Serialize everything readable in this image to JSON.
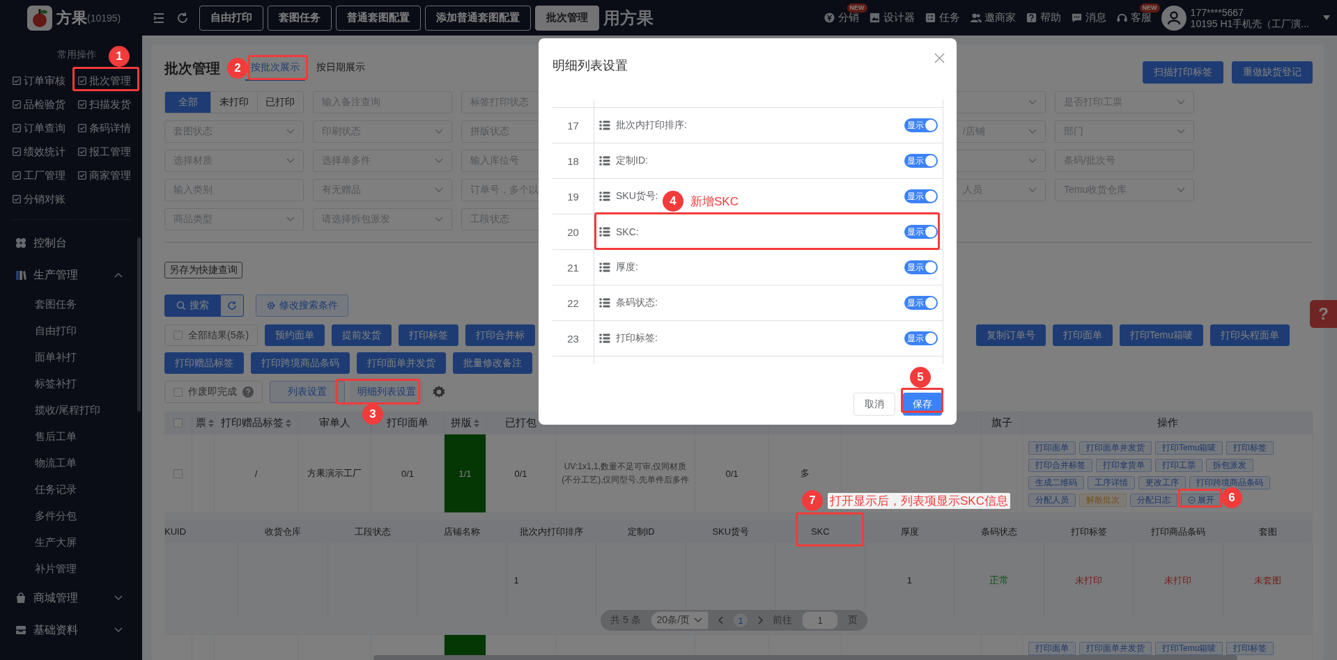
{
  "topbar": {
    "brand": "方果",
    "account": "(10195)",
    "banner_text": "用方果",
    "tabs": [
      {
        "label": "自由打印",
        "selected": false
      },
      {
        "label": "套图任务",
        "selected": false
      },
      {
        "label": "普通套图配置",
        "selected": false
      },
      {
        "label": "添加普通套图配置",
        "selected": false
      },
      {
        "label": "批次管理",
        "selected": true
      }
    ],
    "tools": [
      {
        "label": "分销",
        "badge": "NEW"
      },
      {
        "label": "设计器"
      },
      {
        "label": "任务"
      },
      {
        "label": "邀商家"
      },
      {
        "label": "帮助"
      },
      {
        "label": "消息"
      },
      {
        "label": "客服",
        "badge": "NEW"
      }
    ],
    "user": {
      "phone": "177****5667",
      "org": "10195  H1手机壳（工厂演..."
    }
  },
  "sidebar": {
    "quick_title": "常用操作",
    "quick_links": [
      "订单审核",
      "批次管理",
      "品检验货",
      "扫描发货",
      "订单查询",
      "条码详情",
      "绩效统计",
      "报工管理",
      "工厂管理",
      "商家管理",
      "分销对账"
    ],
    "menu": [
      {
        "label": "控制台",
        "kind": "link"
      },
      {
        "label": "生产管理",
        "kind": "group",
        "expanded": true,
        "children": [
          "套图任务",
          "自由打印",
          "面单补打",
          "标签补打",
          "揽收/尾程打印",
          "售后工单",
          "物流工单",
          "任务记录",
          "多件分包",
          "生产大屏",
          "补片管理"
        ]
      },
      {
        "label": "商城管理",
        "kind": "group",
        "expanded": false
      },
      {
        "label": "基础资料",
        "kind": "group",
        "expanded": false
      }
    ]
  },
  "page": {
    "title": "批次管理",
    "view_tabs": [
      {
        "label": "按批次展示",
        "selected": true
      },
      {
        "label": "按日期展示",
        "selected": false
      }
    ],
    "header_buttons": [
      "扫描打印标签",
      "重做缺货登记"
    ],
    "filter_rows": [
      {
        "segments": [
          {
            "label": "全部",
            "selected": true
          },
          {
            "label": "未打印",
            "selected": false
          },
          {
            "label": "已打印",
            "selected": false
          }
        ],
        "left": [
          {
            "kind": "input",
            "placeholder": "输入备注查询"
          },
          {
            "kind": "select",
            "placeholder": "标签打印状态"
          }
        ],
        "right": [
          {
            "kind": "select"
          },
          {
            "kind": "select",
            "placeholder": "是否打印工票"
          }
        ]
      },
      {
        "left": [
          {
            "kind": "select",
            "placeholder": "套图状态"
          },
          {
            "kind": "select",
            "placeholder": "印刷状态"
          },
          {
            "kind": "select",
            "placeholder": "拼版状态"
          }
        ],
        "right": [
          {
            "kind": "select",
            "placeholder": "/店铺"
          },
          {
            "kind": "select",
            "placeholder": "部门"
          }
        ]
      },
      {
        "left": [
          {
            "kind": "select",
            "placeholder": "选择材质"
          },
          {
            "kind": "select",
            "placeholder": "选择单多件"
          },
          {
            "kind": "input",
            "placeholder": "输入库位号"
          }
        ],
        "right": [
          {
            "kind": "select"
          },
          {
            "kind": "input",
            "placeholder": "条码/批次号"
          }
        ]
      },
      {
        "left": [
          {
            "kind": "input",
            "placeholder": "输入类别"
          },
          {
            "kind": "select",
            "placeholder": "有无赠品"
          },
          {
            "kind": "input",
            "placeholder": "订单号，多个以"
          }
        ],
        "right": [
          {
            "kind": "select",
            "placeholder": "人员"
          },
          {
            "kind": "select",
            "placeholder": "Temu收货仓库"
          }
        ]
      },
      {
        "left": [
          {
            "kind": "select",
            "placeholder": "商品类型"
          },
          {
            "kind": "select",
            "placeholder": "请选择拆包派发"
          },
          {
            "kind": "input",
            "placeholder": "工段状态"
          }
        ]
      }
    ],
    "save_query_button": "另存为快捷查询",
    "search_button": "搜索",
    "edit_conditions_button": "修改搜索条件",
    "select_all": {
      "label": "全部结果(5条)",
      "checked": false
    },
    "action_rows": [
      {
        "left": [
          "预约面单",
          "提前发货",
          "打印标签",
          "打印合并标"
        ],
        "right": [
          "复制订单号",
          "打印面单",
          "打印Temu箱唛",
          "打印头程面单"
        ]
      },
      {
        "left": [
          "打印赠品标签",
          "打印跨境商品条码",
          "打印面单并发货",
          "批量修改备注"
        ]
      }
    ],
    "void_complete": {
      "label": "作废即完成",
      "checked": false
    },
    "list_settings_button": "列表设置",
    "detail_settings_button": "明细列表设置",
    "table": {
      "columns": [
        {
          "kind": "checkbox",
          "checked": false
        },
        {
          "kind": "sortable",
          "label": "票"
        },
        {
          "kind": "sortable",
          "label": "打印赠品标签"
        },
        {
          "kind": "plain",
          "label": "审单人"
        },
        {
          "kind": "plain",
          "label": "打印面单"
        },
        {
          "kind": "sortable",
          "label": "拼版"
        },
        {
          "kind": "plain",
          "label": "已打包"
        },
        {
          "kind": "blank"
        },
        {
          "kind": "blank"
        },
        {
          "kind": "blank"
        },
        {
          "kind": "blank"
        },
        {
          "kind": "plain",
          "label": "旗子"
        },
        {
          "kind": "plain",
          "label": "操作"
        }
      ],
      "rows": [
        {
          "cells": [
            {
              "kind": "checkbox",
              "checked": false
            },
            null,
            {
              "kind": "text",
              "text": "/"
            },
            {
              "kind": "text",
              "text": "方果演示工厂"
            },
            {
              "kind": "text",
              "text": "0/1"
            },
            {
              "kind": "block",
              "text": "1/1",
              "complete": true
            },
            {
              "kind": "text",
              "text": "0/1"
            },
            {
              "kind": "note",
              "text": "UV:1x1,1,数量不足可审,仅同材质(不分工艺),仅同型号,先单件后多件"
            },
            {
              "kind": "text",
              "text": "0/1"
            },
            {
              "kind": "text",
              "text": "多"
            },
            null,
            null,
            {
              "kind": "actions",
              "actions": [
                {
                  "label": "打印面单",
                  "kind": "default"
                },
                {
                  "label": "打印面单并发货",
                  "kind": "default"
                },
                {
                  "label": "打印Temu箱唛",
                  "kind": "default"
                },
                {
                  "label": "打印标签",
                  "kind": "default"
                },
                {
                  "label": "打印合并标签",
                  "kind": "default"
                },
                {
                  "label": "打印拿货单",
                  "kind": "default"
                },
                {
                  "label": "打印工票",
                  "kind": "default"
                },
                {
                  "label": "拆包派发",
                  "kind": "default"
                },
                {
                  "label": "生成二维码",
                  "kind": "default"
                },
                {
                  "label": "工序详情",
                  "kind": "default"
                },
                {
                  "label": "更改工序",
                  "kind": "default"
                },
                {
                  "label": "打印跨境商品条码",
                  "kind": "default"
                },
                {
                  "label": "分配人员",
                  "kind": "default"
                },
                {
                  "label": "解散批次",
                  "kind": "warning"
                },
                {
                  "label": "分配日志",
                  "kind": "default"
                },
                {
                  "label": "展开",
                  "kind": "expand"
                }
              ]
            }
          ],
          "detail": {
            "columns": [
              "KUID",
              "收货仓库",
              "工段状态",
              "店铺名称",
              "批次内打印排序",
              "定制ID",
              "SKU货号",
              "SKC",
              "厚度",
              "条码状态",
              "打印标签",
              "打印商品条码",
              "套图"
            ],
            "rows": [
              [
                null,
                null,
                null,
                null,
                {
                  "text": "1",
                  "kind": "plain"
                },
                null,
                null,
                null,
                {
                  "text": "1",
                  "kind": "plain"
                },
                {
                  "text": "正常",
                  "kind": "ok"
                },
                {
                  "text": "未打印",
                  "kind": "bad"
                },
                {
                  "text": "未打印",
                  "kind": "bad"
                },
                {
                  "text": "未套图",
                  "kind": "bad"
                }
              ]
            ]
          }
        },
        {
          "cells": [
            null,
            null,
            null,
            null,
            null,
            {
              "kind": "block",
              "complete": true
            },
            null,
            null,
            null,
            null,
            null,
            null,
            {
              "kind": "actions",
              "actions": [
                {
                  "label": "打印面单",
                  "kind": "default"
                },
                {
                  "label": "打印面单并发货",
                  "kind": "default"
                },
                {
                  "label": "打印Temu箱唛",
                  "kind": "default"
                },
                {
                  "label": "打印标签",
                  "kind": "default"
                }
              ]
            }
          ]
        }
      ]
    },
    "pagination": {
      "total": "共 5 条",
      "page_size": "20条/页",
      "current_page": "1",
      "goto_label": "前往",
      "goto_value": "1",
      "page_unit": "页"
    },
    "help_float": "?"
  },
  "modal": {
    "title": "明细列表设置",
    "rows": [
      {
        "index": "17",
        "label": "批次内打印排序:",
        "on": true,
        "toggle_text": "显示"
      },
      {
        "index": "18",
        "label": "定制ID:",
        "on": true,
        "toggle_text": "显示"
      },
      {
        "index": "19",
        "label": "SKU货号:",
        "on": true,
        "toggle_text": "显示"
      },
      {
        "index": "20",
        "label": "SKC:",
        "on": true,
        "toggle_text": "显示"
      },
      {
        "index": "21",
        "label": "厚度:",
        "on": true,
        "toggle_text": "显示"
      },
      {
        "index": "22",
        "label": "条码状态:",
        "on": true,
        "toggle_text": "显示"
      },
      {
        "index": "23",
        "label": "打印标签:",
        "on": true,
        "toggle_text": "显示"
      }
    ],
    "buttons": [
      {
        "label": "取消",
        "kind": "default"
      },
      {
        "label": "保存",
        "kind": "primary"
      }
    ]
  },
  "annotations": [
    {
      "number": "1"
    },
    {
      "number": "2"
    },
    {
      "number": "3"
    },
    {
      "number": "4",
      "note": "新增SKC"
    },
    {
      "number": "5"
    },
    {
      "number": "6"
    },
    {
      "number": "7",
      "note": "打开显示后，列表项显示SKC信息"
    }
  ]
}
